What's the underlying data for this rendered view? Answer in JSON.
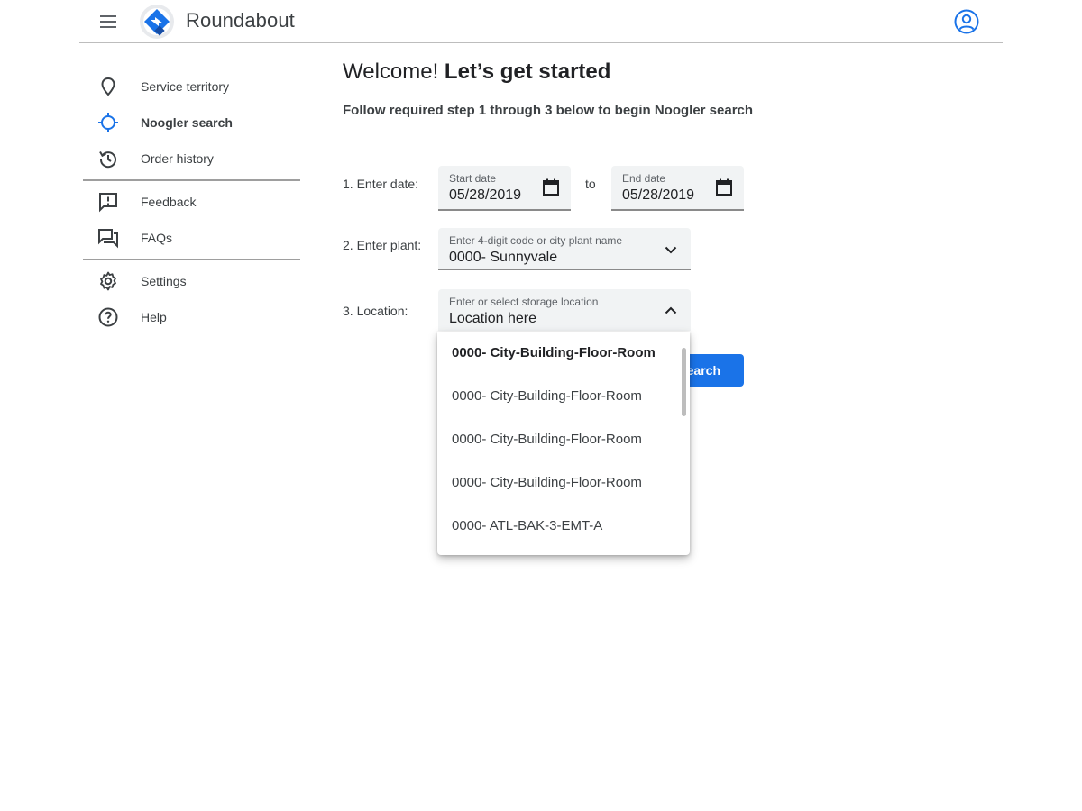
{
  "header": {
    "app_title": "Roundabout",
    "menu_icon": "hamburger-menu-icon",
    "logo_icon": "roundabout-logo",
    "account_icon": "account-circle-icon"
  },
  "sidebar": {
    "items": [
      {
        "label": "Service territory",
        "icon": "location-pin-icon",
        "active": false
      },
      {
        "label": "Noogler search",
        "icon": "crosshair-icon",
        "active": true
      },
      {
        "label": "Order history",
        "icon": "history-icon",
        "active": false
      },
      {
        "label": "Feedback",
        "icon": "feedback-icon",
        "active": false
      },
      {
        "label": "FAQs",
        "icon": "forum-icon",
        "active": false
      },
      {
        "label": "Settings",
        "icon": "gear-icon",
        "active": false
      },
      {
        "label": "Help",
        "icon": "help-circle-icon",
        "active": false
      }
    ]
  },
  "main": {
    "welcome_prefix": "Welcome! ",
    "welcome_bold": "Let’s get started",
    "instruction": "Follow required step 1 through 3 below to begin Noogler search",
    "step1_label": "1. Enter date:",
    "start_date_label": "Start date",
    "start_date_value": "05/28/2019",
    "to_text": "to",
    "end_date_label": "End date",
    "end_date_value": "05/28/2019",
    "step2_label": "2. Enter plant:",
    "plant_label": "Enter 4-digit code or city plant name",
    "plant_value": "0000- Sunnyvale",
    "step3_label": "3. Location:",
    "location_label": "Enter or select storage location",
    "location_value": "Location here",
    "search_button": "Search"
  },
  "dropdown": {
    "options": [
      "0000- City-Building-Floor-Room",
      "0000- City-Building-Floor-Room",
      "0000- City-Building-Floor-Room",
      "0000- City-Building-Floor-Room",
      "0000- ATL-BAK-3-EMT-A"
    ]
  },
  "colors": {
    "accent": "#1a73e8",
    "logo_blue": "#1a73e8",
    "text_primary": "#202124",
    "text_secondary": "#3c4043",
    "field_bg": "#f1f3f4"
  }
}
